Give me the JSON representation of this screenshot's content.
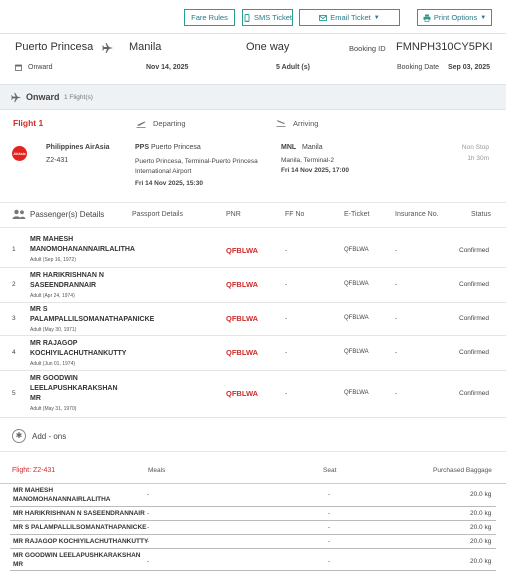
{
  "toolbar": {
    "fare_rules": "Fare Rules",
    "sms_ticket": "SMS Ticket",
    "email_ticket": "Email Ticket",
    "print_options": "Print Options"
  },
  "summary": {
    "origin": "Puerto Princesa",
    "destination": "Manila",
    "trip_type": "One way",
    "booking_id_label": "Booking ID",
    "booking_id": "FMNPH310CY5PKI",
    "onward_label": "Onward",
    "onward_date": "Nov 14, 2025",
    "pax_count": "5 Adult (s)",
    "booking_date_label": "Booking Date",
    "booking_date": "Sep 03, 2025"
  },
  "onward_bar": {
    "title": "Onward",
    "count": "1 Flight(s)"
  },
  "flight": {
    "title": "Flight 1",
    "departing_label": "Departing",
    "arriving_label": "Arriving",
    "airline_logo": "AirAsia",
    "airline": "Philippines AirAsia",
    "flight_no": "Z2-431",
    "dep_code": "PPS",
    "dep_city": "Puerto Princesa",
    "dep_terminal": "Puerto Princesa, Terminal-Puerto Princesa International Airport",
    "dep_time": "Fri 14 Nov 2025, 15:30",
    "arr_code": "MNL",
    "arr_city": "Manila",
    "arr_terminal": "Manila, Terminal-2",
    "arr_time": "Fri 14 Nov 2025, 17:00",
    "stops": "Non Stop",
    "duration": "1h 30m"
  },
  "passengers": {
    "headers": {
      "details": "Passenger(s) Details",
      "passport": "Passport Details",
      "pnr": "PNR",
      "ff": "FF No",
      "eticket": "E-Ticket",
      "insurance": "Insurance No.",
      "status": "Status"
    },
    "rows": [
      {
        "num": "1",
        "name": "MR MAHESH MANOMOHANANNAIRLALITHA",
        "sub": "Adult (Sep 16, 1972)",
        "pnr": "QFBLWA",
        "ff": "-",
        "eticket": "QFBLWA",
        "insurance": "-",
        "status": "Confirmed"
      },
      {
        "num": "2",
        "name": "MR HARIKRISHNAN N SASEENDRANNAIR",
        "sub": "Adult (Apr 24, 1974)",
        "pnr": "QFBLWA",
        "ff": "-",
        "eticket": "QFBLWA",
        "insurance": "-",
        "status": "Confirmed"
      },
      {
        "num": "3",
        "name": "MR S PALAMPALLILSOMANATHAPANICKE",
        "sub": "Adult (May 30, 1971)",
        "pnr": "QFBLWA",
        "ff": "-",
        "eticket": "QFBLWA",
        "insurance": "-",
        "status": "Confirmed"
      },
      {
        "num": "4",
        "name": "MR RAJAGOP KOCHIYILACHUTHANKUTTY",
        "sub": "Adult (Jun 01, 1974)",
        "pnr": "QFBLWA",
        "ff": "-",
        "eticket": "QFBLWA",
        "insurance": "-",
        "status": "Confirmed"
      },
      {
        "num": "5",
        "name": "MR GOODWIN LEELAPUSHKARAKSHAN MR",
        "sub": "Adult (May 31, 1970)",
        "pnr": "QFBLWA",
        "ff": "-",
        "eticket": "QFBLWA",
        "insurance": "-",
        "status": "Confirmed"
      }
    ]
  },
  "addons": {
    "label": "Add - ons"
  },
  "baggage": {
    "flight_label": "Flight: Z2-431",
    "meals_label": "Meals",
    "seat_label": "Seat",
    "baggage_label": "Purchased Baggage",
    "rows": [
      {
        "name": "MR MAHESH MANOMOHANANNAIRLALITHA",
        "meals": "-",
        "seat": "-",
        "baggage": "20.0 kg"
      },
      {
        "name": "MR HARIKRISHNAN N SASEENDRANNAIR",
        "meals": "-",
        "seat": "-",
        "baggage": "20.0 kg"
      },
      {
        "name": "MR S PALAMPALLILSOMANATHAPANICKE",
        "meals": "-",
        "seat": "-",
        "baggage": "20.0 kg"
      },
      {
        "name": "MR RAJAGOP KOCHIYILACHUTHANKUTTY",
        "meals": "-",
        "seat": "-",
        "baggage": "20.0 kg"
      },
      {
        "name": "MR GOODWIN LEELAPUSHKARAKSHAN MR",
        "meals": "-",
        "seat": "-",
        "baggage": "20.0 kg"
      }
    ]
  },
  "colors": {
    "accent": "#2a9d8f",
    "pnr_red": "#d12c2c",
    "bar_bg": "#eef2f5"
  },
  "icons": {
    "plane": "plane-icon",
    "calendar": "calendar-icon",
    "takeoff": "takeoff-icon",
    "landing": "landing-icon",
    "people": "people-icon",
    "add": "add-circle-icon",
    "phone": "phone-icon",
    "email": "email-icon",
    "print": "print-icon"
  }
}
